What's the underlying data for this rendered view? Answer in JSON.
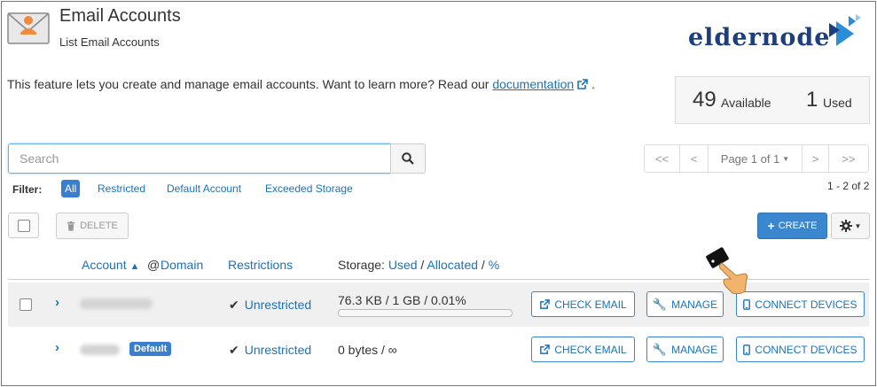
{
  "header": {
    "title": "Email Accounts",
    "subtitle": "List Email Accounts",
    "logo_text": "eldernode"
  },
  "intro": {
    "text": "This feature lets you create and manage email accounts. Want to learn more? Read our",
    "link_label": "documentation",
    "trailing": "."
  },
  "stats": {
    "available_count": "49",
    "available_label": "Available",
    "used_count": "1",
    "used_label": "Used"
  },
  "search": {
    "placeholder": "Search",
    "value": ""
  },
  "pager": {
    "first": "<<",
    "prev": "<",
    "page_label": "Page 1 of 1",
    "next": ">",
    "last": ">>",
    "range": "1 - 2 of 2"
  },
  "filter": {
    "label": "Filter:",
    "options": [
      "All",
      "Restricted",
      "Default Account",
      "Exceeded Storage"
    ],
    "active": "All"
  },
  "toolbar": {
    "delete_label": "DELETE",
    "create_label": "CREATE"
  },
  "columns": {
    "account": "Account",
    "at_domain": "@ Domain",
    "restrictions": "Restrictions",
    "storage_prefix": "Storage:",
    "storage_used": "Used",
    "storage_sep1": "/",
    "storage_allocated": "Allocated",
    "storage_sep2": "/",
    "storage_percent": "%"
  },
  "rows": [
    {
      "badge": "",
      "restriction": "Unrestricted",
      "storage": "76.3 KB / 1 GB / 0.01%",
      "usage_fraction": 0.0001,
      "check_email": "CHECK EMAIL",
      "manage": "MANAGE",
      "connect": "CONNECT DEVICES"
    },
    {
      "badge": "Default",
      "restriction": "Unrestricted",
      "storage": "0 bytes / ∞",
      "check_email": "CHECK EMAIL",
      "manage": "MANAGE",
      "connect": "CONNECT DEVICES"
    }
  ],
  "colors": {
    "accent": "#3a87d0",
    "link": "#1a73b6",
    "logo": "#1d3f80"
  }
}
